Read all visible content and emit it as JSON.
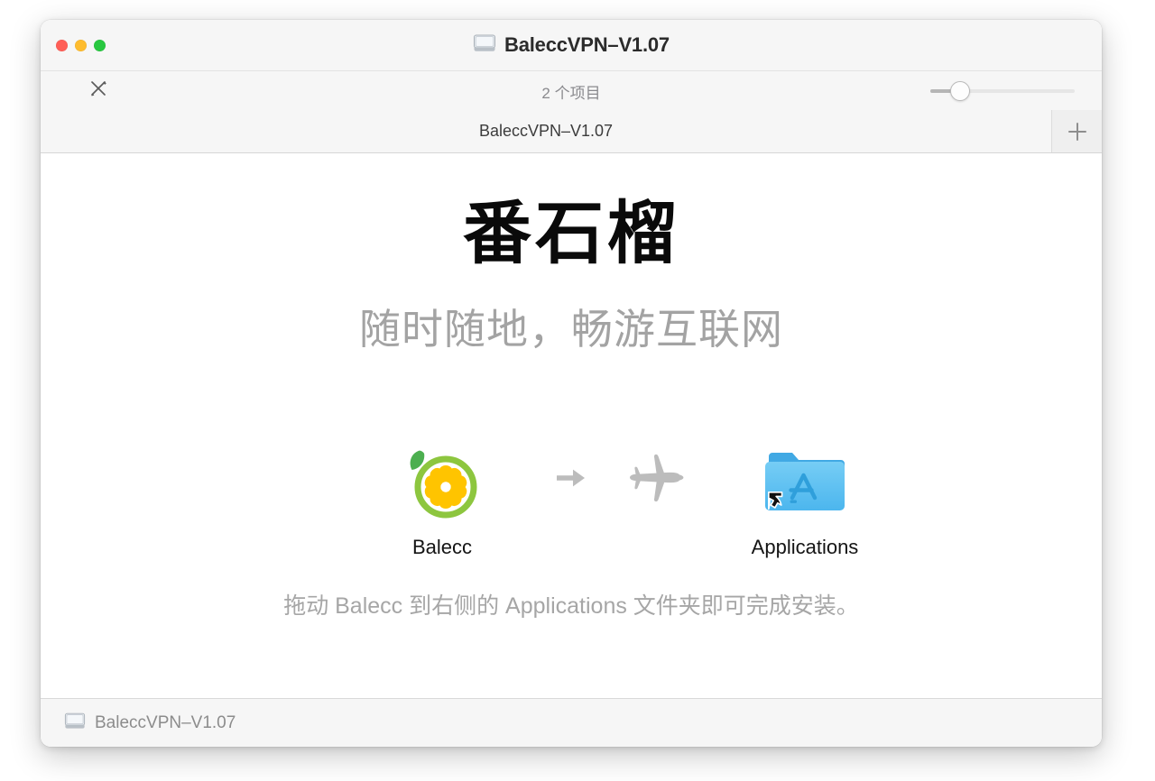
{
  "window": {
    "title": "BaleccVPN–V1.07",
    "title_icon": "disk-drive-icon",
    "traffic_lights": [
      {
        "name": "close",
        "color": "#ff5f57"
      },
      {
        "name": "minimize",
        "color": "#febc2e"
      },
      {
        "name": "zoom",
        "color": "#28c840"
      }
    ]
  },
  "toolbar": {
    "markup_icon": "markup-pen-pencil-icon",
    "item_count": "2 个项目",
    "zoom_slider": {
      "name": "icon-size-slider",
      "value": 14
    }
  },
  "tabbar": {
    "active_tab_label": "BaleccVPN–V1.07",
    "add_tab_icon": "plus-icon"
  },
  "content": {
    "brand_title": "番石榴",
    "brand_subtitle": "随时随地，畅游互联网",
    "source": {
      "label": "Balecc",
      "icon": "guava-citrus-app-icon"
    },
    "target": {
      "label": "Applications",
      "icon": "applications-folder-alias-icon"
    },
    "arrow_icon": "right-arrow-icon",
    "plane_icon": "airplane-icon",
    "hint": "拖动 Balecc 到右侧的 Applications 文件夹即可完成安装。"
  },
  "statusbar": {
    "path_icon": "disk-drive-icon",
    "path_label": "BaleccVPN–V1.07"
  },
  "colors": {
    "leaf_green": "#4caf50",
    "ring_green": "#8dc63f",
    "segment_yellow": "#ffc400",
    "folder_blue": "#61c3f2",
    "folder_blue_dark": "#41b0e8",
    "arrow_gray": "#bcbcbc"
  }
}
